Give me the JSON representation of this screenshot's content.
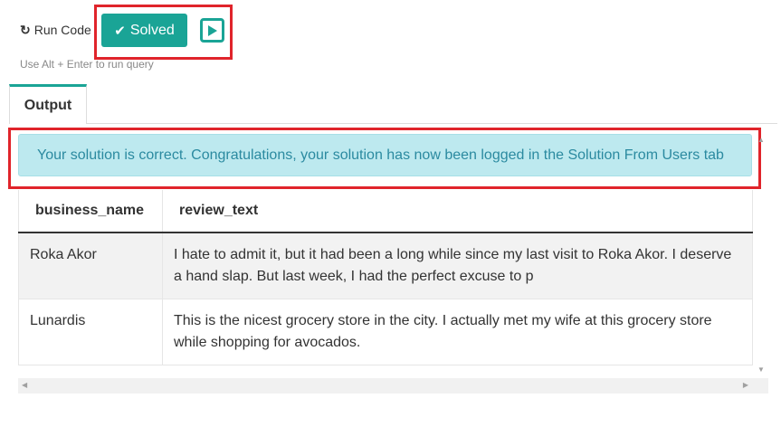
{
  "toolbar": {
    "run_code_icon": "refresh-icon",
    "run_code_label": "Run Code",
    "solved_icon": "check-icon",
    "solved_label": "Solved",
    "play_icon": "play-icon",
    "hint": "Use Alt + Enter to run query"
  },
  "tabs": [
    {
      "label": "Output",
      "active": true
    }
  ],
  "alert": {
    "message": "Your solution is correct. Congratulations, your solution has now been logged in the Solution From Users tab"
  },
  "table": {
    "columns": [
      "business_name",
      "review_text"
    ],
    "rows": [
      [
        "Roka Akor",
        "I hate to admit it, but it had been a long while since my last visit to Roka Akor. I deserve a hand slap. But last week, I had the perfect excuse to p"
      ],
      [
        "Lunardis",
        "This is the nicest grocery store in the city. I actually met my wife at this grocery store while shopping for avocados."
      ]
    ]
  },
  "colors": {
    "accent": "#1aa496",
    "highlight_border": "#e0242b",
    "alert_bg": "#bde9ef",
    "alert_text": "#2b8aa0"
  }
}
